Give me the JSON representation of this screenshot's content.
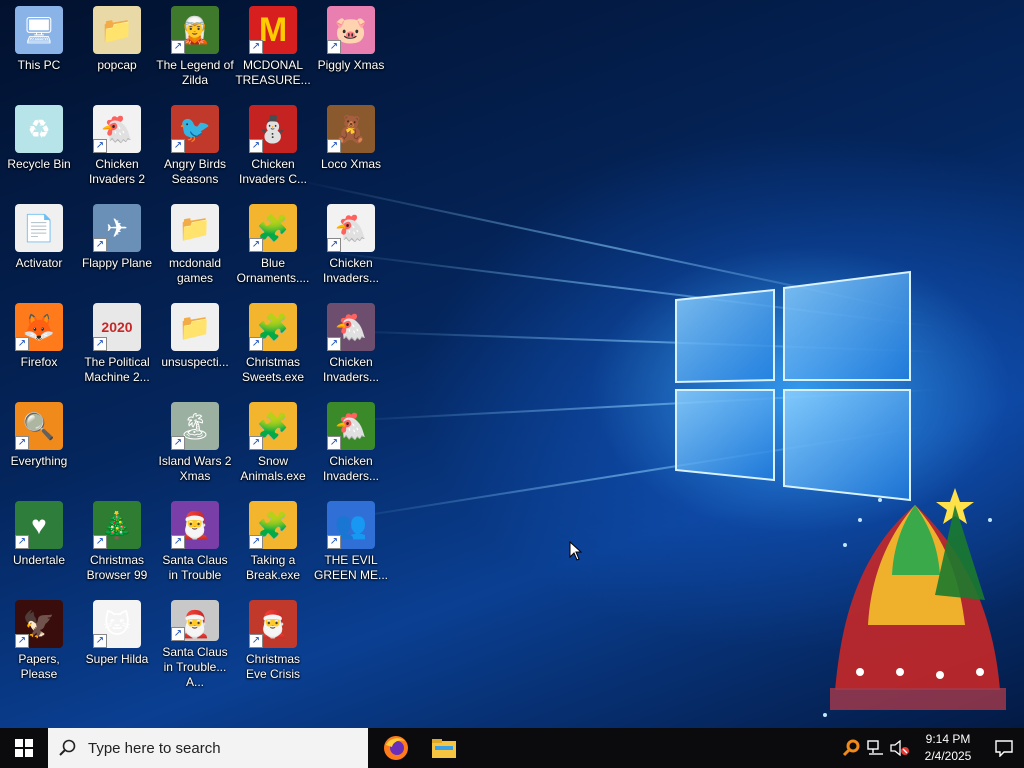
{
  "desktop": {
    "icons": [
      {
        "label": "This PC",
        "glyph": "computer-icon",
        "color": "#8ab4e8",
        "sym": "🖥",
        "shortcut": false
      },
      {
        "label": "popcap",
        "glyph": "folder-icon",
        "color": "#e9d9a6",
        "sym": "📁",
        "shortcut": false
      },
      {
        "label": "The Legend of Zilda",
        "glyph": "game-icon",
        "color": "#3f7a2c",
        "sym": "🧝",
        "shortcut": true
      },
      {
        "label": "MCDONAL TREASURE...",
        "glyph": "mcdonalds-icon",
        "color": "#d71f1f",
        "sym": "M",
        "shortcut": true
      },
      {
        "label": "Piggly Xmas",
        "glyph": "pig-icon",
        "color": "#e97fb0",
        "sym": "🐷",
        "shortcut": true
      },
      {
        "label": "Recycle Bin",
        "glyph": "recycle-bin-icon",
        "color": "#b7e4e9",
        "sym": "♻",
        "shortcut": false
      },
      {
        "label": "Chicken Invaders 2",
        "glyph": "chicken-icon",
        "color": "#f2f2f2",
        "sym": "🐔",
        "shortcut": true
      },
      {
        "label": "Angry Birds Seasons",
        "glyph": "angry-bird-icon",
        "color": "#c0392b",
        "sym": "🐦",
        "shortcut": true
      },
      {
        "label": "Chicken Invaders C...",
        "glyph": "snowman-icon",
        "color": "#c52222",
        "sym": "⛄",
        "shortcut": true
      },
      {
        "label": "Loco Xmas",
        "glyph": "bear-icon",
        "color": "#8a5a2e",
        "sym": "🧸",
        "shortcut": true
      },
      {
        "label": "Activator",
        "glyph": "file-icon",
        "color": "#f0f0f0",
        "sym": "📄",
        "shortcut": false
      },
      {
        "label": "Flappy Plane",
        "glyph": "plane-icon",
        "color": "#6b90b8",
        "sym": "✈",
        "shortcut": true
      },
      {
        "label": "mcdonald games",
        "glyph": "folder-icon",
        "color": "#f0f0f0",
        "sym": "📁",
        "shortcut": false
      },
      {
        "label": "Blue Ornaments....",
        "glyph": "puzzle-icon",
        "color": "#f3b52d",
        "sym": "🧩",
        "shortcut": true
      },
      {
        "label": "Chicken Invaders...",
        "glyph": "chicken-icon",
        "color": "#f2f2f2",
        "sym": "🐔",
        "shortcut": true
      },
      {
        "label": "Firefox",
        "glyph": "firefox-icon",
        "color": "#ff7a1a",
        "sym": "🦊",
        "shortcut": true
      },
      {
        "label": "The Political Machine 2...",
        "glyph": "political-icon",
        "color": "#e8e8e8",
        "sym": "2020",
        "shortcut": true
      },
      {
        "label": "unsuspecti...",
        "glyph": "folder-icon",
        "color": "#f0f0f0",
        "sym": "📁",
        "shortcut": false
      },
      {
        "label": "Christmas Sweets.exe",
        "glyph": "puzzle-icon",
        "color": "#f3b52d",
        "sym": "🧩",
        "shortcut": true
      },
      {
        "label": "Chicken Invaders...",
        "glyph": "chicken-icon",
        "color": "#6e4e6e",
        "sym": "🐔",
        "shortcut": true
      },
      {
        "label": "Everything",
        "glyph": "everything-icon",
        "color": "#f08a1a",
        "sym": "🔍",
        "shortcut": true
      },
      {
        "label": "",
        "glyph": "",
        "color": "",
        "sym": "",
        "shortcut": false
      },
      {
        "label": "Island Wars 2 Xmas",
        "glyph": "island-icon",
        "color": "#9bb0a0",
        "sym": "🏝",
        "shortcut": true
      },
      {
        "label": "Snow Animals.exe",
        "glyph": "puzzle-icon",
        "color": "#f3b52d",
        "sym": "🧩",
        "shortcut": true
      },
      {
        "label": "Chicken Invaders...",
        "glyph": "chicken-icon",
        "color": "#3a8a2a",
        "sym": "🐔",
        "shortcut": true
      },
      {
        "label": "Undertale",
        "glyph": "undertale-icon",
        "color": "#2f7d3a",
        "sym": "♥",
        "shortcut": true
      },
      {
        "label": "Christmas Browser 99",
        "glyph": "tree-icon",
        "color": "#2e7d32",
        "sym": "🎄",
        "shortcut": true
      },
      {
        "label": "Santa Claus in Trouble",
        "glyph": "santa-icon",
        "color": "#7a3ea8",
        "sym": "🎅",
        "shortcut": true
      },
      {
        "label": "Taking a Break.exe",
        "glyph": "puzzle-icon",
        "color": "#f3b52d",
        "sym": "🧩",
        "shortcut": true
      },
      {
        "label": "THE EVIL GREEN ME...",
        "glyph": "messenger-icon",
        "color": "#2f6fd6",
        "sym": "👥",
        "shortcut": true
      },
      {
        "label": "Papers, Please",
        "glyph": "papers-please-icon",
        "color": "#3a0d0d",
        "sym": "🦅",
        "shortcut": true
      },
      {
        "label": "Super Hilda",
        "glyph": "pixel-cat-icon",
        "color": "#f4f4f4",
        "sym": "🐱",
        "shortcut": true
      },
      {
        "label": "Santa Claus in Trouble... A...",
        "glyph": "santa-icon",
        "color": "#c8c8c8",
        "sym": "🎅",
        "shortcut": true
      },
      {
        "label": "Christmas Eve Crisis",
        "glyph": "santa-icon",
        "color": "#c0392b",
        "sym": "🎅",
        "shortcut": true
      }
    ]
  },
  "taskbar": {
    "search_placeholder": "Type here to search",
    "time": "9:14 PM",
    "date": "2/4/2025"
  },
  "colors": {
    "taskbar": "#0b0b0d",
    "search_bg": "#f3f3f3",
    "wallpaper_glow": "#3caaff"
  }
}
